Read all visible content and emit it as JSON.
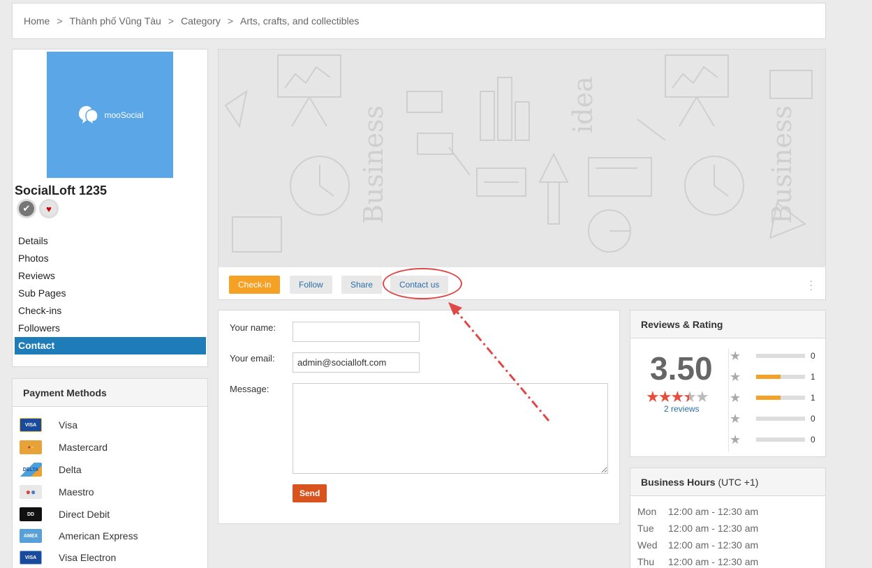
{
  "breadcrumb": {
    "items": [
      "Home",
      "Thành phố Vũng Tàu",
      "Category",
      "Arts, crafts, and collectibles"
    ],
    "separator": ">"
  },
  "profile": {
    "logo_text": "mooSocial",
    "name": "SocialLoft 1235",
    "nav": [
      {
        "label": "Details"
      },
      {
        "label": "Photos"
      },
      {
        "label": "Reviews"
      },
      {
        "label": "Sub Pages"
      },
      {
        "label": "Check-ins"
      },
      {
        "label": "Followers"
      },
      {
        "label": "Contact",
        "active": true
      }
    ]
  },
  "payment": {
    "title": "Payment Methods",
    "items": [
      {
        "label": "Visa",
        "icon": "visa-card-icon",
        "color": "#1a4a9c"
      },
      {
        "label": "Mastercard",
        "icon": "mastercard-card-icon",
        "color": "#e8a23a"
      },
      {
        "label": "Delta",
        "icon": "delta-card-icon",
        "color": "#4aa0d8"
      },
      {
        "label": "Maestro",
        "icon": "maestro-card-icon",
        "color": "#d64545"
      },
      {
        "label": "Direct Debit",
        "icon": "direct-debit-card-icon",
        "color": "#111111"
      },
      {
        "label": "American Express",
        "icon": "amex-card-icon",
        "color": "#5aa0d8"
      },
      {
        "label": "Visa Electron",
        "icon": "visa-electron-card-icon",
        "color": "#1a4a9c"
      }
    ]
  },
  "actions": {
    "checkin": "Check-in",
    "follow": "Follow",
    "share": "Share",
    "contact": "Contact us"
  },
  "form": {
    "name_label": "Your name:",
    "name_value": "",
    "email_label": "Your email:",
    "email_value": "admin@socialloft.com",
    "message_label": "Message:",
    "message_value": "",
    "send_label": "Send"
  },
  "reviews": {
    "title": "Reviews & Rating",
    "average": "3.50",
    "count_text": "2 reviews",
    "stars_value": 3.5,
    "breakdown": [
      {
        "stars": 5,
        "count": "0",
        "fill": 0
      },
      {
        "stars": 4,
        "count": "1",
        "fill": 0.5
      },
      {
        "stars": 3,
        "count": "1",
        "fill": 0.5
      },
      {
        "stars": 2,
        "count": "0",
        "fill": 0
      },
      {
        "stars": 1,
        "count": "0",
        "fill": 0
      }
    ]
  },
  "hours": {
    "title": "Business Hours",
    "timezone": "(UTC +1)",
    "rows": [
      {
        "day": "Mon",
        "time": "12:00 am - 12:30 am"
      },
      {
        "day": "Tue",
        "time": "12:00 am - 12:30 am"
      },
      {
        "day": "Wed",
        "time": "12:00 am - 12:30 am"
      },
      {
        "day": "Thu",
        "time": "12:00 am - 12:30 am"
      }
    ]
  },
  "colors": {
    "accent_orange": "#f5a125",
    "active_nav": "#1e7cb8",
    "send_button": "#d9531e",
    "annotation_red": "#e04848"
  }
}
